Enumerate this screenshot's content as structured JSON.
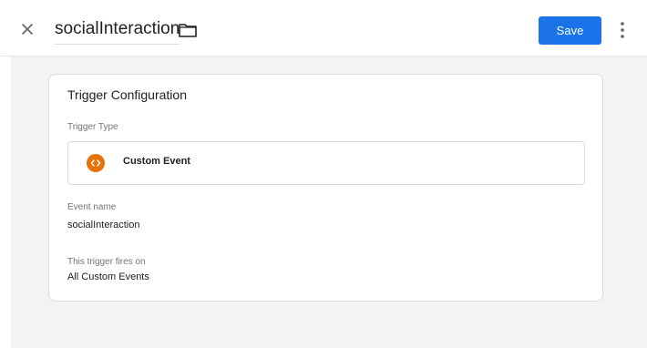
{
  "header": {
    "title": "socialInteraction",
    "save_label": "Save",
    "accent_color": "#1a73e8"
  },
  "card": {
    "title": "Trigger Configuration",
    "trigger_type": {
      "label": "Trigger Type",
      "value": "Custom Event",
      "icon": "custom-event-icon",
      "icon_color": "#e8710a"
    },
    "event_name": {
      "label": "Event name",
      "value": "socialInteraction"
    },
    "fires_on": {
      "label": "This trigger fires on",
      "value": "All Custom Events"
    }
  },
  "icons": {
    "close": "close-icon",
    "folder": "folder-icon",
    "more": "more-vert-icon"
  }
}
